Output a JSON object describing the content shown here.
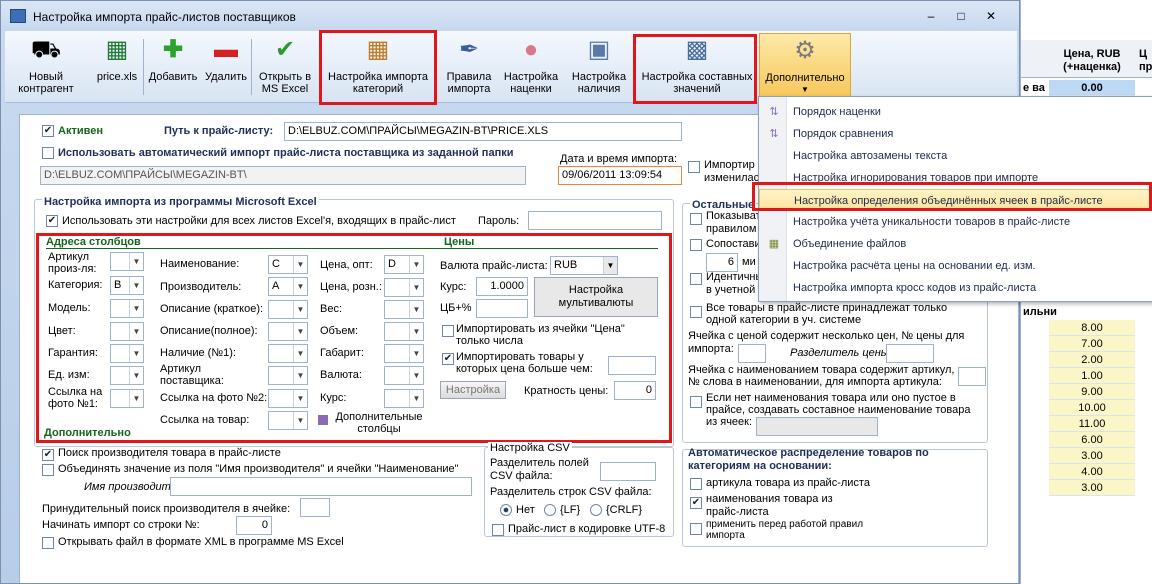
{
  "window": {
    "title": "Настройка импорта прайс-листов поставщиков"
  },
  "toolbar": {
    "new_supplier": "Новый контрагент",
    "price_xls": "price.xls",
    "add": "Добавить",
    "delete": "Удалить",
    "open_excel": "Открыть в MS Excel",
    "category_import": "Настройка импорта категорий",
    "import_rules": "Правила импорта",
    "markup": "Настройка наценки",
    "availability": "Настройка наличия",
    "composite": "Настройка составных значений",
    "additional": "Дополнительно"
  },
  "menu": {
    "items": [
      "Порядок наценки",
      "Порядок сравнения",
      "Настройка автозамены текста",
      "Настройка игнорирования товаров при импорте",
      "Настройка определения объединённых ячеек в прайс-листе",
      "Настройка учёта уникальности товаров в прайс-листе",
      "Объединение файлов",
      "Настройка расчёта цены на основании ед. изм.",
      "Настройка импорта кросс кодов из прайс-листа"
    ]
  },
  "form": {
    "active": "Активен",
    "path_label": "Путь к прайс-листу:",
    "path_value": "D:\\ELBUZ.COM\\ПРАЙСЫ\\MEGAZIN-BT\\PRICE.XLS",
    "auto_import": "Использовать автоматический импорт прайс-листа поставщика из заданной папки",
    "folder_value": "D:\\ELBUZ.COM\\ПРАЙСЫ\\MEGAZIN-BT\\",
    "date_label": "Дата и время импорта:",
    "date_value": "09/06/2011 13:09:54",
    "import_changed_1": "Импортир",
    "import_changed_2": "изменилас",
    "excel_group": "Настройка импорта из программы Microsoft Excel",
    "use_settings": "Использовать эти настройки для всех листов Excel'я, входящих в прайс-лист",
    "password_label": "Пароль:",
    "columns_title": "Адреса столбцов",
    "prices_title": "Цены",
    "article_label": "Артикул произ-ля:",
    "category_label": "Категория:",
    "category_value": "B",
    "model_label": "Модель:",
    "color_label": "Цвет:",
    "warranty_label": "Гарантия:",
    "unit_label": "Ед. изм:",
    "photo_link_label": "Ссылка на фото №1:",
    "name_label": "Наименование:",
    "name_value": "C",
    "maker_label": "Производитель:",
    "maker_value": "A",
    "desc_short_label": "Описание (краткое):",
    "desc_full_label": "Описание(полное):",
    "availability_label": "Наличие (№1):",
    "supplier_article_label": "Артикул поставщика:",
    "photo2_label": "Ссылка на фото №2:",
    "product_link_label": "Ссылка на товар:",
    "price_opt_label": "Цена, опт:",
    "price_opt_value": "D",
    "price_retail_label": "Цена, розн.:",
    "weight_label": "Вес:",
    "volume_label": "Объем:",
    "size_label": "Габарит:",
    "currency_label": "Валюта:",
    "rate_label": "Курс:",
    "extra_columns": "Дополнительные столбцы",
    "price_currency_label": "Валюта прайс-листа:",
    "price_currency_value": "RUB",
    "rate2_label": "Курс:",
    "rate2_value": "1.0000",
    "cb_label": "ЦБ+%",
    "multicurrency_button": "Настройка мультивалюты",
    "import_from_price_cell": "Импортировать из ячейки \"Цена\" только числа",
    "import_price_greater": "Импортировать товары у которых цена больше чем:",
    "settings_button": "Настройка",
    "price_multiplicity_label": "Кратность цены:",
    "price_multiplicity_value": "0",
    "additional_title": "Дополнительно",
    "search_maker": "Поиск производителя товара в прайс-листе",
    "combine_name": "Объединять значение из поля \"Имя производителя\" и ячейки \"Наименование\"",
    "maker_name_label": "Имя производителя:",
    "force_search_label": "Принудительный поиск производителя в ячейке:",
    "start_row_label": "Начинать импорт со строки №:",
    "start_row_value": "0",
    "open_xml": "Открывать файл в формате XML в программе MS Excel",
    "csv_title": "Настройка CSV",
    "csv_field_sep": "Разделитель полей CSV файла:",
    "csv_row_sep": "Разделитель строк CSV файла:",
    "csv_none": "Нет",
    "csv_lf": "{LF}",
    "csv_crlf": "{CRLF}",
    "utf8": "Прайс-лист в кодировке UTF-8",
    "rest_title": "Остальные",
    "show_1": "Показыват",
    "show_2": "правилом и",
    "compare": "Сопостави",
    "num6": "6",
    "min_suffix": "ми",
    "identical_1": "Идентичны",
    "identical_2": "в учетной",
    "all_goods": "Все товары в прайс-листе принадлежат только одной категории в уч. системе",
    "multi_price": "Ячейка с ценой содержит несколько цен, № цены для импорта:",
    "price_sep_label": "Разделитель цены:",
    "article_in_name": "Ячейка с наименованием товара содержит артикул, № слова в наименовании, для импорта артикула:",
    "composite_name": "Если нет наименования товара или оно пустое в прайсе, создавать составное наименование товара из ячеек:",
    "auto_dist_title": "Автоматическое распределение товаров по категориям на основании:",
    "by_article": "артикула товара из прайс-листа",
    "by_name": "наименования товара из прайс-листа",
    "apply_rules": "применить перед работой правил импорта"
  },
  "grid": {
    "header": "Цена, RUB (+наценка)",
    "header2": "Ц\nпра",
    "row0": "0.00",
    "label_ve": "е ва",
    "label_ilni": "ильни",
    "values": [
      "8.00",
      "7.00",
      "2.00",
      "1.00",
      "9.00",
      "10.00",
      "11.00",
      "6.00",
      "3.00",
      "4.00",
      "3.00"
    ]
  }
}
